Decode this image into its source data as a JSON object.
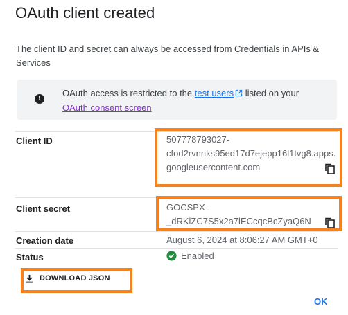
{
  "dialog": {
    "title": "OAuth client created",
    "description": "The client ID and secret can always be accessed from Credentials in APIs & Services"
  },
  "info_banner": {
    "icon": "info-icon",
    "text_before": "OAuth access is restricted to the ",
    "test_users_link": "test users",
    "text_after": " listed on your ",
    "consent_screen_link": "OAuth consent screen"
  },
  "details": {
    "client_id": {
      "label": "Client ID",
      "value_line1": "507778793027-",
      "value_line2": "cfod2rvnnks95ed17d7ejepp16l1tvg8.apps.",
      "value_line3": "googleusercontent.com"
    },
    "client_secret": {
      "label": "Client secret",
      "value_line1": "GOCSPX-",
      "value_line2": "_dRKlZC7S5x2a7lECcqcBcZyaQ6N"
    },
    "creation_date": {
      "label": "Creation date",
      "value": "August 6, 2024 at 8:06:27 AM GMT+0"
    },
    "status": {
      "label": "Status",
      "value": "Enabled"
    }
  },
  "actions": {
    "download_label": "DOWNLOAD JSON",
    "ok_label": "OK"
  },
  "colors": {
    "highlight": "#f4821f",
    "link": "#1a73e8",
    "visited_link": "#8430ce",
    "status_green": "#1e8e3e"
  }
}
